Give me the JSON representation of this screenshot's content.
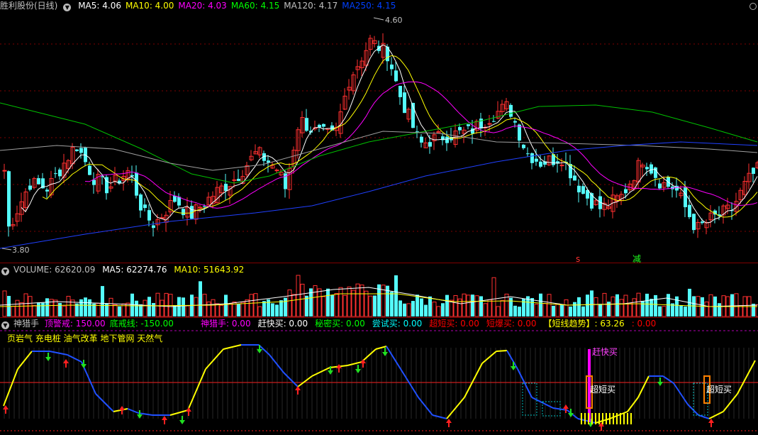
{
  "main": {
    "title": "胜利股份(日线)",
    "ma": [
      {
        "label": "MA5: 4.06",
        "color": "#ffffff"
      },
      {
        "label": "MA10: 4.00",
        "color": "#ffff00"
      },
      {
        "label": "MA20: 4.03",
        "color": "#ff00ff"
      },
      {
        "label": "MA60: 4.15",
        "color": "#00ff00"
      },
      {
        "label": "MA120: 4.17",
        "color": "#c0c0c0"
      },
      {
        "label": "MA250: 4.15",
        "color": "#0040ff"
      }
    ],
    "high_label": "4.60",
    "low_label": "3.80",
    "sig_s": "s",
    "sig_jian": "减",
    "ylim": [
      3.72,
      4.66
    ]
  },
  "volume": {
    "label": "VOLUME: 62620.09",
    "ma5": "MA5: 62274.76",
    "ma10": "MA10: 51643.92"
  },
  "indicator": {
    "name": "神猎手",
    "items": [
      {
        "label": "顶警戒: 150.00",
        "color": "#ff00ff"
      },
      {
        "label": "底戒线: -150.00",
        "color": "#00ff00"
      }
    ],
    "items2": [
      {
        "label": "神猎手: 0.00",
        "color": "#ff00ff"
      },
      {
        "label": "赶快买: 0.00",
        "color": "#ffffff"
      },
      {
        "label": "秘密买: 0.00",
        "color": "#00ff00"
      },
      {
        "label": "尝试买: 0.00",
        "color": "#00ffff"
      },
      {
        "label": "超短买: 0.00",
        "color": "#ff0000"
      },
      {
        "label": "短爆买: 0.00",
        "color": "#ff0000"
      },
      {
        "label": "【短线趋势】: 63.26",
        "color": "#ffff00"
      },
      {
        "label": ": 0.00",
        "color": "#ff0000"
      }
    ],
    "subtitle": "页岩气 充电桩 油气改革 地下管网 天然气",
    "ganmai": "赶快买",
    "chaoduan1": "超短买",
    "chaoduan2": "超短买"
  },
  "colors": {
    "up": "#ff3030",
    "down": "#54fcfc",
    "bg": "#000000",
    "sep": "#800000"
  }
}
